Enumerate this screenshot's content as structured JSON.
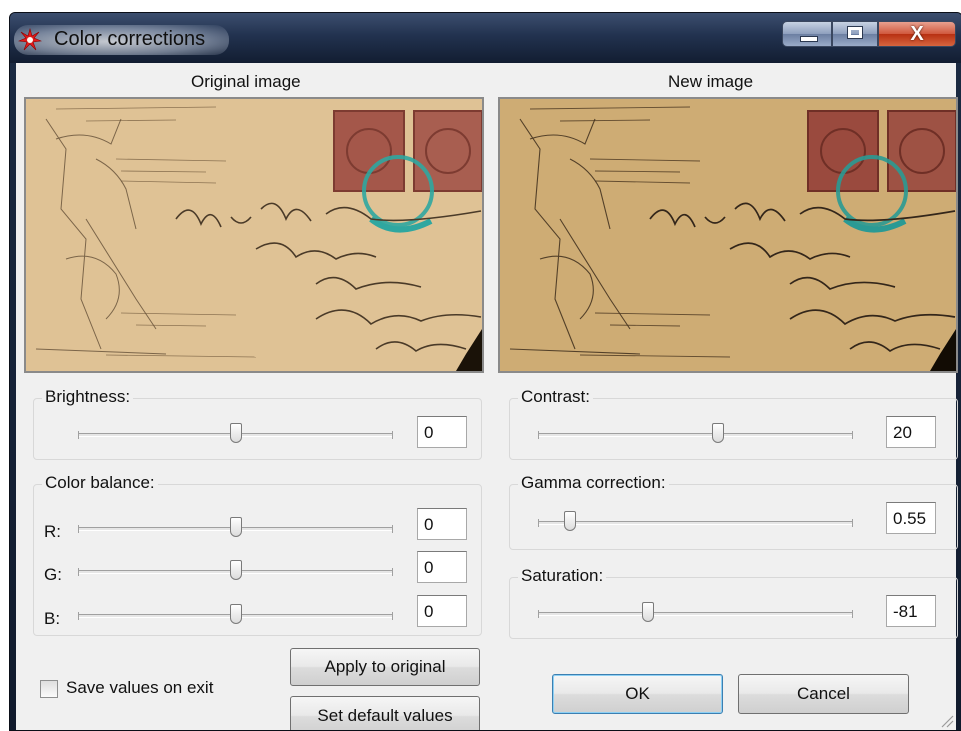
{
  "window": {
    "title": "Color corrections",
    "icon": "red-splat-icon",
    "controls": [
      "minimize-icon",
      "maximize-icon",
      "close-icon"
    ],
    "close_glyph": "X"
  },
  "panes": {
    "original_label": "Original image",
    "new_label": "New image"
  },
  "brightness": {
    "label": "Brightness:",
    "value": "0",
    "level": 0.5
  },
  "color_balance": {
    "label": "Color balance:",
    "channels": [
      {
        "label": "R:",
        "value": "0",
        "level": 0.5
      },
      {
        "label": "G:",
        "value": "0",
        "level": 0.5
      },
      {
        "label": "B:",
        "value": "0",
        "level": 0.5
      }
    ]
  },
  "contrast": {
    "label": "Contrast:",
    "value": "20",
    "level": 0.57
  },
  "gamma": {
    "label": "Gamma correction:",
    "value": "0.55",
    "level": 0.1
  },
  "saturation": {
    "label": "Saturation:",
    "value": "-81",
    "level": 0.35
  },
  "buttons": {
    "apply": "Apply to original",
    "defaults": "Set default values",
    "ok": "OK",
    "cancel": "Cancel"
  },
  "save_on_exit": {
    "label": "Save values on exit",
    "checked": false
  },
  "colors": {
    "paper_original": "#d9b98a",
    "paper_new": "#c9a46c",
    "stamp": "#a4574a",
    "postmark": "#2fa7a0",
    "ink": "#5a4630",
    "accent_ok": "#3c7fb1"
  }
}
